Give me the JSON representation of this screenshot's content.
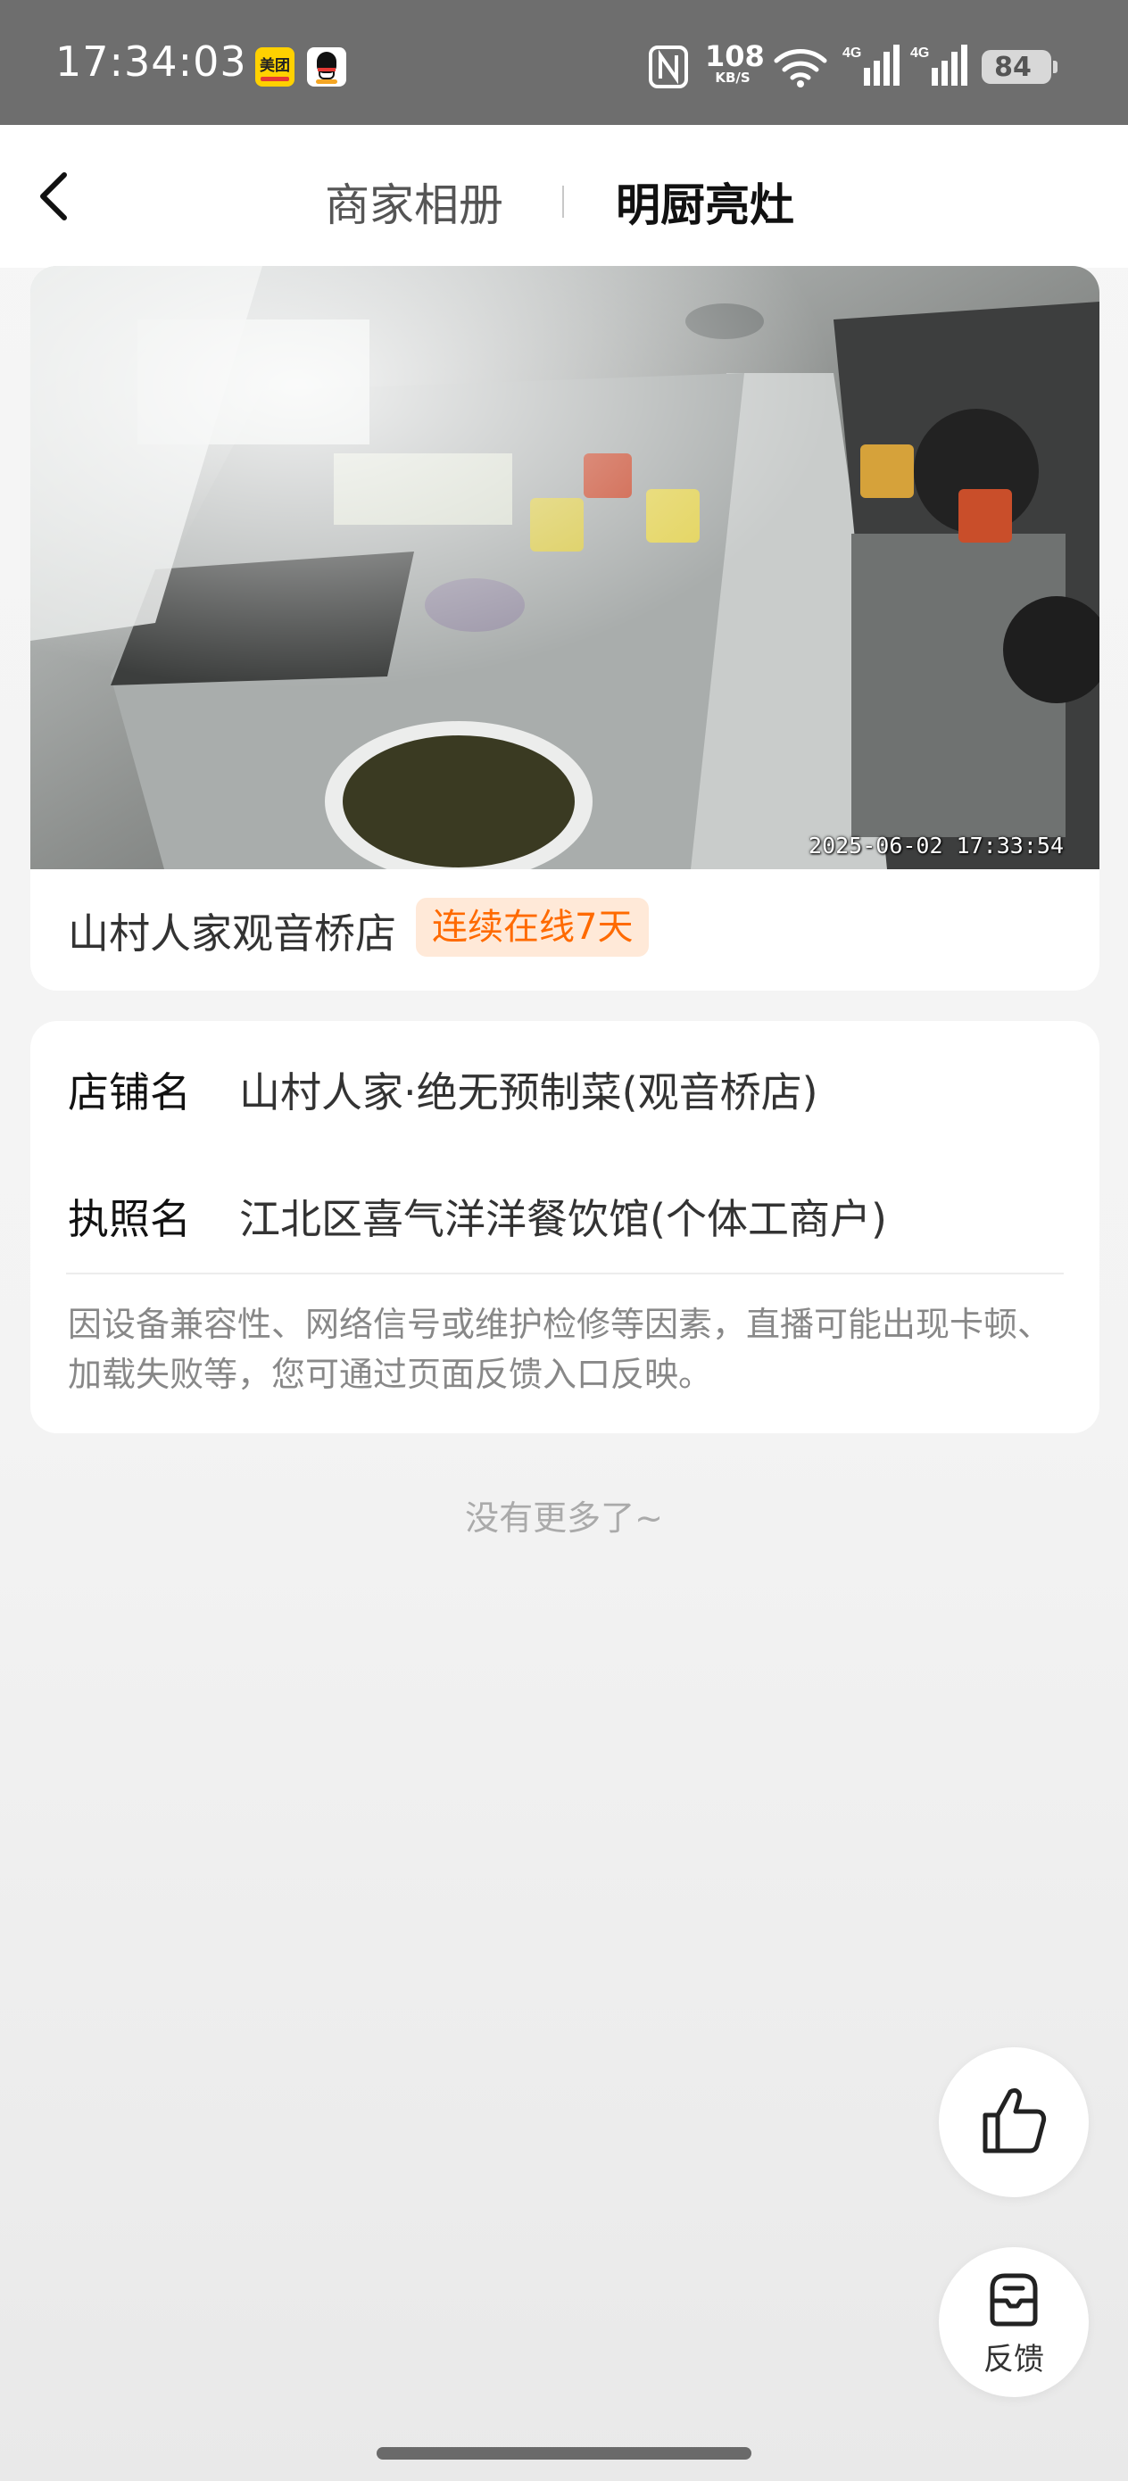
{
  "status_bar": {
    "time": "17:34:03",
    "meituan_icon_text": "美团",
    "net_speed": "108",
    "net_speed_unit": "KB/S",
    "signal_labels": [
      "4G",
      "4G"
    ],
    "battery": "84"
  },
  "header": {
    "tabs": [
      {
        "label": "商家相册",
        "active": false
      },
      {
        "label": "明厨亮灶",
        "active": true
      }
    ]
  },
  "live_card": {
    "timestamp": "2025-06-02 17:33:54",
    "shop_name": "山村人家观音桥店",
    "online_badge": "连续在线7天"
  },
  "info_card": {
    "rows": [
      {
        "label": "店铺名",
        "value": "山村人家·绝无预制菜(观音桥店)"
      },
      {
        "label": "执照名",
        "value": "江北区喜气洋洋餐饮馆(个体工商户)"
      }
    ],
    "notice": "因设备兼容性、网络信号或维护检修等因素，直播可能出现卡顿、加载失败等，您可通过页面反馈入口反映。"
  },
  "footer_text": "没有更多了~",
  "floating": {
    "feedback_label": "反馈"
  },
  "colors": {
    "accent_orange": "#ff6a00",
    "badge_bg": "#ffe9d8",
    "status_bar_bg": "#6e6e6e"
  }
}
